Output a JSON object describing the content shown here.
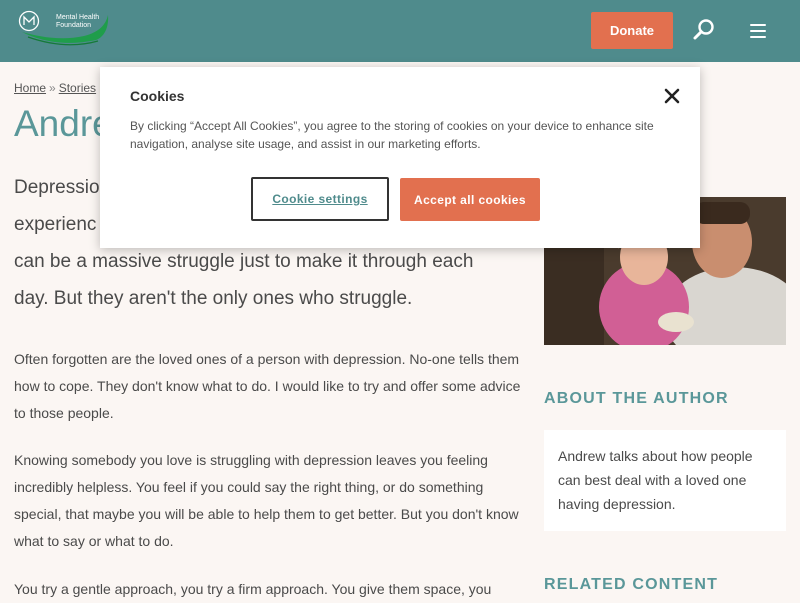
{
  "header": {
    "logo_line1": "Mental Health",
    "logo_line2": "Foundation",
    "donate_label": "Donate",
    "brand_color": "#4f8b8c",
    "accent_color": "#e2704f",
    "search_icon": "search-icon",
    "menu_icon": "hamburger-menu-icon"
  },
  "breadcrumb": {
    "items": [
      "Home",
      "Stories"
    ],
    "separator": "»"
  },
  "article": {
    "title_visible": "Andre",
    "intro_lines": [
      "Depression",
      "experienc",
      "can be a massive struggle just to make it through each",
      "day. But they aren't the only ones who struggle."
    ],
    "paragraphs": [
      "Often forgotten are the loved ones of a person with depression. No-one tells them how to cope. They don't know what to do. I would like to try and offer some advice to those people.",
      "Knowing somebody you love is struggling with depression leaves you feeling incredibly helpless. You feel if you could say the right thing, or do something special, that maybe you will be able to help them to get better. But you don't know what to say or what to do.",
      "You try a gentle approach, you try a firm approach. You give them space, you"
    ]
  },
  "sidebar": {
    "about_heading": "ABOUT THE AUTHOR",
    "about_text": "Andrew talks about how people can best deal with a loved one having depression.",
    "related_heading": "RELATED CONTENT"
  },
  "cookie_modal": {
    "title": "Cookies",
    "close_icon": "close-icon",
    "body": "By clicking “Accept All Cookies”, you agree to the storing of cookies on your device to enhance site navigation, analyse site usage, and assist in our marketing efforts.",
    "settings_label": "Cookie settings",
    "accept_label": "Accept all cookies"
  }
}
